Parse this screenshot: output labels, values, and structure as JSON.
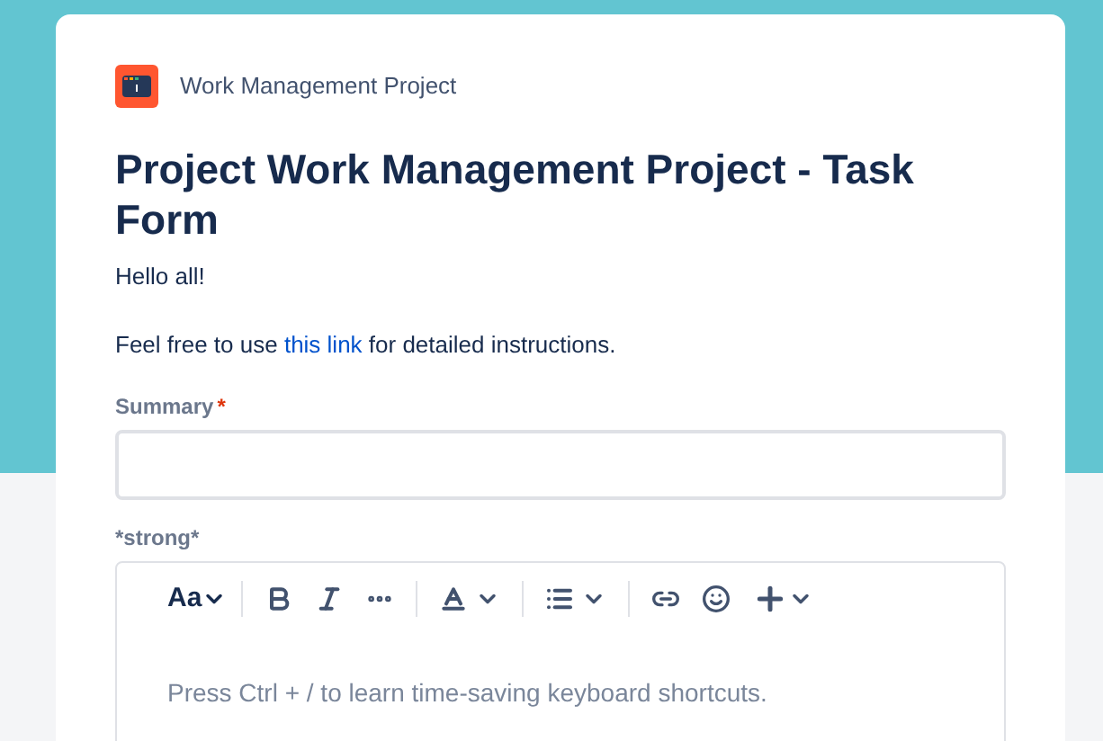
{
  "project": {
    "name": "Work Management Project"
  },
  "title": "Project Work Management Project - Task Form",
  "intro": [
    "Hello all!"
  ],
  "instructions": {
    "before": "Feel free to use ",
    "link": "this link",
    "after": " for detailed instructions."
  },
  "fields": [
    {
      "kind": "text",
      "label": "Summary",
      "required": true,
      "required_mark": "*"
    },
    {
      "kind": "editor",
      "label": "*strong*",
      "toolbar_text_style": "Aa",
      "placeholder": "Press Ctrl + / to learn time-saving keyboard shortcuts."
    }
  ]
}
